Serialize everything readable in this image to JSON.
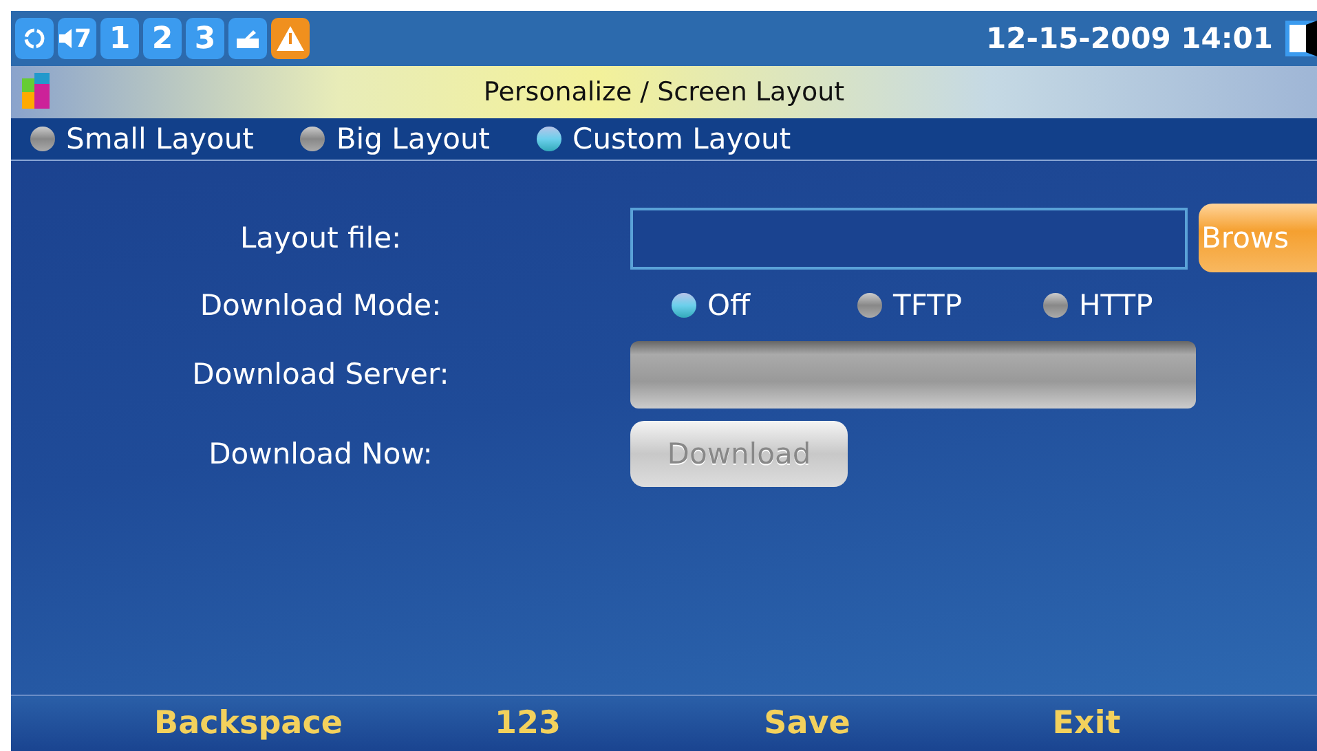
{
  "status_bar": {
    "volume": "7",
    "lines": [
      "1",
      "2",
      "3"
    ],
    "datetime": "12-15-2009 14:01"
  },
  "title": "Personalize / Screen Layout",
  "tabs": [
    {
      "label": "Small Layout",
      "selected": false
    },
    {
      "label": "Big Layout",
      "selected": false
    },
    {
      "label": "Custom Layout",
      "selected": true
    }
  ],
  "form": {
    "layout_file": {
      "label": "Layout file:",
      "button": "Brows"
    },
    "download_mode": {
      "label": "Download Mode:",
      "options": [
        {
          "label": "Off",
          "selected": true
        },
        {
          "label": "TFTP",
          "selected": false
        },
        {
          "label": "HTTP",
          "selected": false
        }
      ]
    },
    "download_server": {
      "label": "Download Server:"
    },
    "download_now": {
      "label": "Download Now:",
      "button": "Download"
    }
  },
  "softkeys": [
    "Backspace",
    "123",
    "Save",
    "Exit"
  ]
}
